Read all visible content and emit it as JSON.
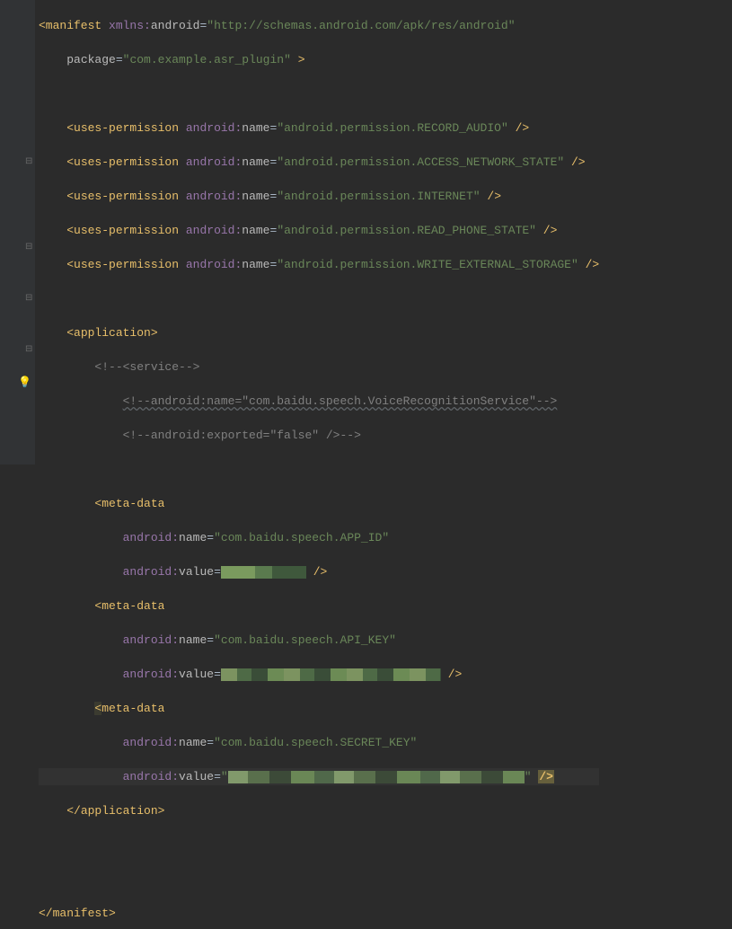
{
  "package": "com.example.asr_plugin",
  "xmlns_android": "http://schemas.android.com/apk/res/android",
  "permission_attr": "android:name",
  "permissions": [
    "android.permission.RECORD_AUDIO",
    "android.permission.ACCESS_NETWORK_STATE",
    "android.permission.INTERNET",
    "android.permission.READ_PHONE_STATE",
    "android.permission.WRITE_EXTERNAL_STORAGE"
  ],
  "tags": {
    "manifest_open": "<manifest",
    "manifest_close": "</manifest>",
    "uses_permission": "<uses-permission",
    "application_open": "<application>",
    "application_close": "</application>",
    "meta_data": "<meta-data",
    "meta_data_bracket": "<",
    "meta_data_rest": "meta-data",
    "self_close": "/>",
    "close_angle": ">"
  },
  "attrs": {
    "xmlns_prefix": "xmlns:",
    "xmlns_local": "android",
    "package": "package",
    "android_prefix": "android:",
    "name": "name",
    "value": "value"
  },
  "comments": {
    "service_open": "<!--<service-->",
    "service_name": "<!--android:name=\"com.baidu.speech.VoiceRecognitionService\"-->",
    "service_exported": "<!--android:exported=\"false\" />-->"
  },
  "meta": [
    {
      "name": "com.baidu.speech.APP_ID"
    },
    {
      "name": "com.baidu.speech.API_KEY"
    },
    {
      "name": "com.baidu.speech.SECRET_KEY"
    }
  ],
  "quote": "\"",
  "equals": "="
}
